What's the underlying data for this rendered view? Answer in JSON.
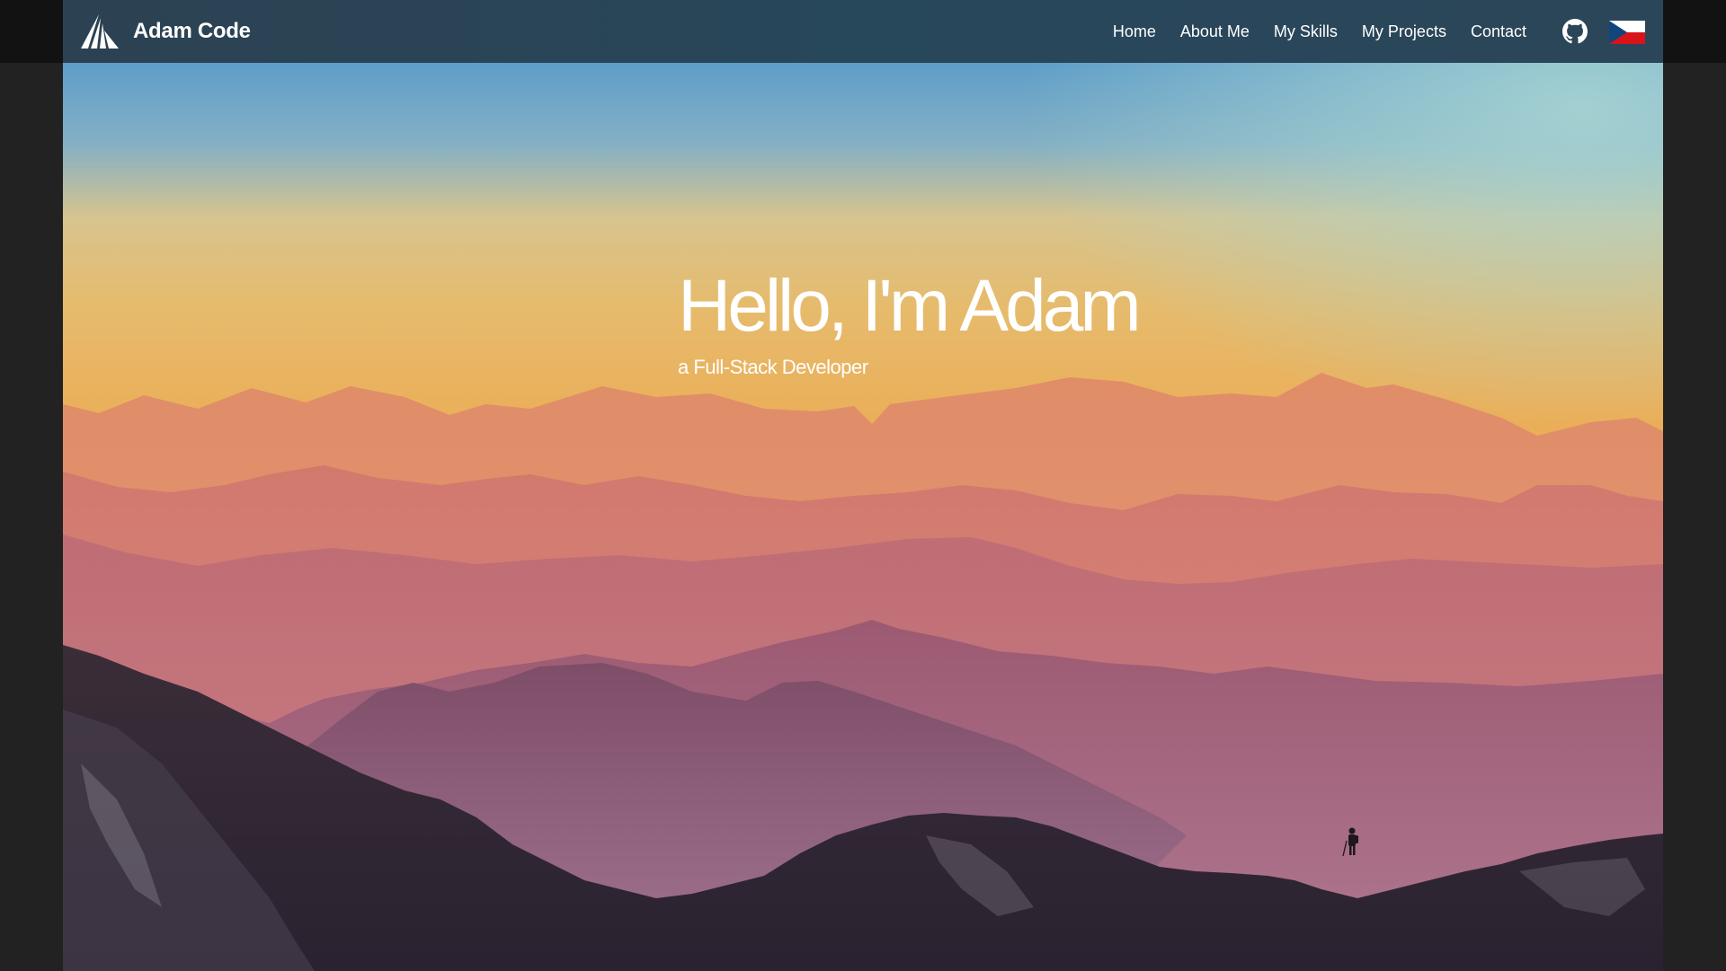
{
  "brand": {
    "name": "Adam Code",
    "logo_icon": "sail-logo-icon"
  },
  "nav": {
    "links": [
      {
        "label": "Home"
      },
      {
        "label": "About Me"
      },
      {
        "label": "My Skills"
      },
      {
        "label": "My Projects"
      },
      {
        "label": "Contact"
      }
    ],
    "github_icon": "github-icon",
    "language_icon": "czech-flag-icon"
  },
  "hero": {
    "title": "Hello, I'm Adam",
    "subtitle": "a Full-Stack Developer",
    "background": "mountain-sunset-landscape-with-hiker"
  },
  "colors": {
    "navbar": "#2a4556",
    "page_background": "#222222",
    "sky_top": "#5f9fc8",
    "sky_middle": "#e9b15e",
    "text": "#ffffff"
  }
}
